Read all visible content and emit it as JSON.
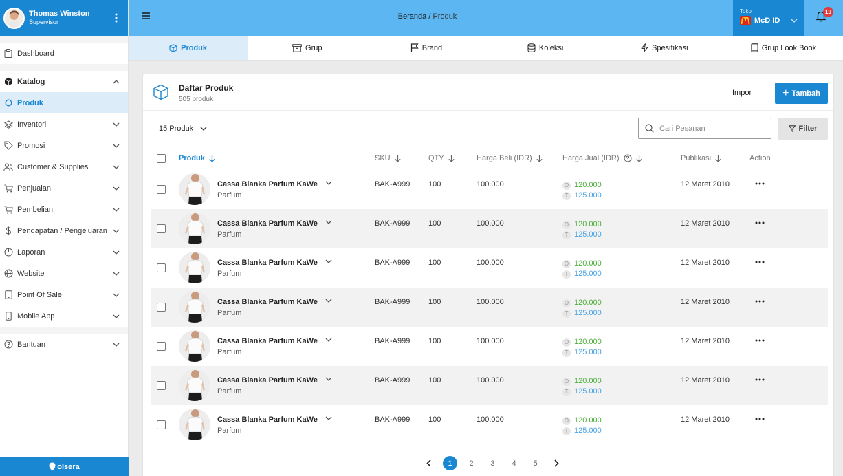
{
  "user": {
    "name": "Thomas Winston",
    "role": "Supervisor"
  },
  "sidebar": {
    "items": [
      {
        "label": "Dashboard",
        "icon": "clipboard-icon"
      },
      {
        "label": "Katalog",
        "icon": "cube-icon",
        "expanded": true
      },
      {
        "label": "Produk",
        "icon": "circle-icon",
        "active": true
      },
      {
        "label": "Inventori",
        "icon": "layers-icon"
      },
      {
        "label": "Promosi",
        "icon": "tag-icon"
      },
      {
        "label": "Customer & Supplies",
        "icon": "users-icon"
      },
      {
        "label": "Penjualan",
        "icon": "cart-icon"
      },
      {
        "label": "Pembelian",
        "icon": "cart-icon"
      },
      {
        "label": "Pendapatan / Pengeluaran",
        "icon": "dollar-icon"
      },
      {
        "label": "Laporan",
        "icon": "pie-chart-icon"
      },
      {
        "label": "Website",
        "icon": "globe-icon"
      },
      {
        "label": "Point Of Sale",
        "icon": "tablet-icon"
      },
      {
        "label": "Mobile App",
        "icon": "mobile-icon"
      },
      {
        "label": "Bantuan",
        "icon": "help-circle-icon"
      }
    ],
    "footer": "olsera"
  },
  "topbar": {
    "breadcrumb_home": "Beranda",
    "breadcrumb_sep": " / ",
    "breadcrumb_current": "Produk",
    "store_caption": "Toko",
    "store_name": "McD ID",
    "notifications": "19"
  },
  "tabs": [
    {
      "label": "Produk",
      "icon": "cube-icon",
      "active": true
    },
    {
      "label": "Grup",
      "icon": "archive-icon"
    },
    {
      "label": "Brand",
      "icon": "flag-icon"
    },
    {
      "label": "Koleksi",
      "icon": "database-icon"
    },
    {
      "label": "Spesifikasi",
      "icon": "zap-icon"
    },
    {
      "label": "Grup Look Book",
      "icon": "book-icon"
    }
  ],
  "card": {
    "title": "Daftar Produk",
    "subtitle": "505 produk",
    "import_label": "Impor",
    "add_label": "Tambah",
    "per_page": "15 Produk",
    "search_placeholder": "Cari Pesanan",
    "filter_label": "Filter"
  },
  "columns": {
    "product": "Produk",
    "sku": "SKU",
    "qty": "QTY",
    "buy_price": "Harga Beli (IDR)",
    "sell_price": "Harga Jual (IDR)",
    "published": "Publikasi",
    "action": "Action"
  },
  "rows": [
    {
      "name": "Cassa Blanka Parfum KaWe",
      "category": "Parfum",
      "sku": "BAK-A999",
      "qty": "100",
      "buy": "100.000",
      "sell_o_tag": "O",
      "sell_o": "120.000",
      "sell_t_tag": "T",
      "sell_t": "125.000",
      "published": "12 Maret 2010"
    },
    {
      "name": "Cassa Blanka Parfum KaWe",
      "category": "Parfum",
      "sku": "BAK-A999",
      "qty": "100",
      "buy": "100.000",
      "sell_o_tag": "O",
      "sell_o": "120.000",
      "sell_t_tag": "T",
      "sell_t": "125.000",
      "published": "12 Maret 2010"
    },
    {
      "name": "Cassa Blanka Parfum KaWe",
      "category": "Parfum",
      "sku": "BAK-A999",
      "qty": "100",
      "buy": "100.000",
      "sell_o_tag": "O",
      "sell_o": "120.000",
      "sell_t_tag": "T",
      "sell_t": "125.000",
      "published": "12 Maret 2010"
    },
    {
      "name": "Cassa Blanka Parfum KaWe",
      "category": "Parfum",
      "sku": "BAK-A999",
      "qty": "100",
      "buy": "100.000",
      "sell_o_tag": "O",
      "sell_o": "120.000",
      "sell_t_tag": "T",
      "sell_t": "125.000",
      "published": "12 Maret 2010"
    },
    {
      "name": "Cassa Blanka Parfum KaWe",
      "category": "Parfum",
      "sku": "BAK-A999",
      "qty": "100",
      "buy": "100.000",
      "sell_o_tag": "O",
      "sell_o": "120.000",
      "sell_t_tag": "T",
      "sell_t": "125.000",
      "published": "12 Maret 2010"
    },
    {
      "name": "Cassa Blanka Parfum KaWe",
      "category": "Parfum",
      "sku": "BAK-A999",
      "qty": "100",
      "buy": "100.000",
      "sell_o_tag": "O",
      "sell_o": "120.000",
      "sell_t_tag": "T",
      "sell_t": "125.000",
      "published": "12 Maret 2010"
    },
    {
      "name": "Cassa Blanka Parfum KaWe",
      "category": "Parfum",
      "sku": "BAK-A999",
      "qty": "100",
      "buy": "100.000",
      "sell_o_tag": "O",
      "sell_o": "120.000",
      "sell_t_tag": "T",
      "sell_t": "125.000",
      "published": "12 Maret 2010"
    }
  ],
  "pagination": {
    "pages": [
      "1",
      "2",
      "3",
      "4",
      "5"
    ],
    "current": "1"
  },
  "colors": {
    "primary": "#1a87d3",
    "topbar": "#5cb6f2",
    "active_bg": "#dcedf9",
    "price_o": "#4caf3a",
    "price_t": "#4aa3e6",
    "badge": "#e23b3b"
  }
}
